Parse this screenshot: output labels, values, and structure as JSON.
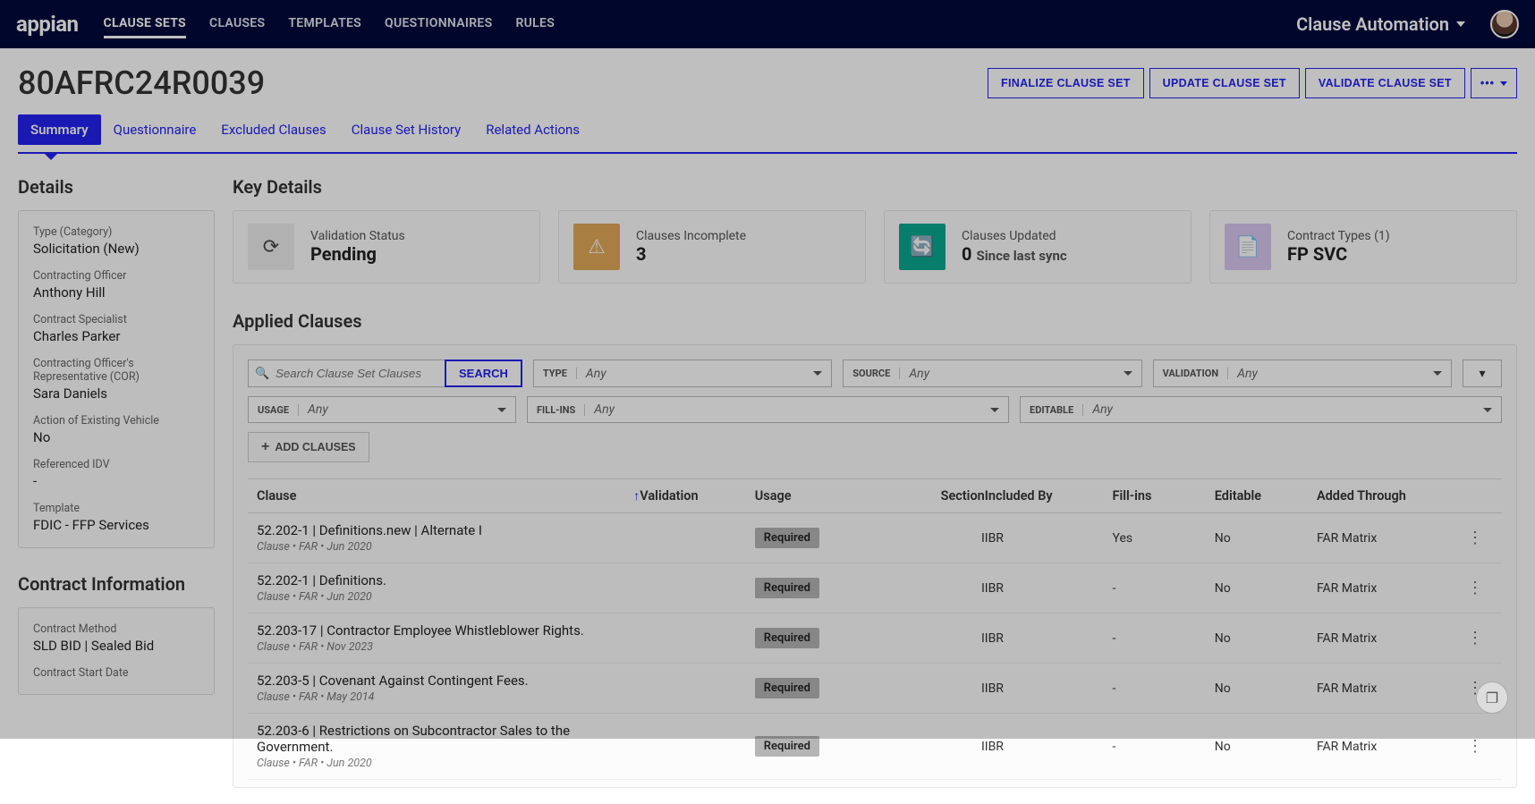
{
  "app": {
    "name": "Clause Automation",
    "logo_text": "appian"
  },
  "nav": {
    "items": [
      {
        "label": "CLAUSE SETS",
        "active": true
      },
      {
        "label": "CLAUSES"
      },
      {
        "label": "TEMPLATES"
      },
      {
        "label": "QUESTIONNAIRES"
      },
      {
        "label": "RULES"
      }
    ]
  },
  "header": {
    "title": "80AFRC24R0039",
    "actions": {
      "finalize": "FINALIZE CLAUSE SET",
      "update": "UPDATE CLAUSE SET",
      "validate": "VALIDATE CLAUSE SET"
    }
  },
  "tabs": [
    {
      "label": "Summary",
      "active": true
    },
    {
      "label": "Questionnaire"
    },
    {
      "label": "Excluded Clauses"
    },
    {
      "label": "Clause Set History"
    },
    {
      "label": "Related Actions"
    }
  ],
  "details": {
    "heading": "Details",
    "items": [
      {
        "label": "Type (Category)",
        "value": "Solicitation (New)"
      },
      {
        "label": "Contracting Officer",
        "value": "Anthony Hill"
      },
      {
        "label": "Contract Specialist",
        "value": "Charles Parker"
      },
      {
        "label": "Contracting Officer's Representative (COR)",
        "value": "Sara Daniels"
      },
      {
        "label": "Action of Existing Vehicle",
        "value": "No"
      },
      {
        "label": "Referenced IDV",
        "value": "-"
      },
      {
        "label": "Template",
        "value": "FDIC - FFP Services"
      }
    ],
    "contract_info_heading": "Contract Information",
    "contract_info": [
      {
        "label": "Contract Method",
        "value": "SLD BID | Sealed Bid"
      },
      {
        "label": "Contract Start Date",
        "value": ""
      }
    ]
  },
  "key_details": {
    "heading": "Key Details",
    "cards": [
      {
        "label": "Validation Status",
        "value": "Pending",
        "icon": "spinner"
      },
      {
        "label": "Clauses Incomplete",
        "value": "3",
        "icon": "warning"
      },
      {
        "label": "Clauses Updated",
        "value": "0",
        "suffix": "Since last sync",
        "icon": "sync"
      },
      {
        "label": "Contract Types (1)",
        "value": "FP SVC",
        "icon": "file"
      }
    ]
  },
  "applied": {
    "heading": "Applied Clauses",
    "search_placeholder": "Search Clause Set Clauses",
    "search_btn": "SEARCH",
    "filters": {
      "type": {
        "label": "TYPE",
        "value": "Any"
      },
      "source": {
        "label": "SOURCE",
        "value": "Any"
      },
      "validation": {
        "label": "VALIDATION",
        "value": "Any"
      },
      "usage": {
        "label": "USAGE",
        "value": "Any"
      },
      "fillins": {
        "label": "FILL-INS",
        "value": "Any"
      },
      "editable": {
        "label": "EDITABLE",
        "value": "Any"
      }
    },
    "add_btn": "ADD CLAUSES",
    "columns": [
      "Clause",
      "Validation",
      "Usage",
      "Section",
      "Included By",
      "Fill-ins",
      "Editable",
      "Added Through"
    ],
    "rows": [
      {
        "title": "52.202-1 | Definitions.new | Alternate I",
        "sub": "Clause • FAR • Jun 2020",
        "validation": "",
        "usage": "Required",
        "section": "I",
        "included_by": "IBR",
        "fill_ins": "Yes",
        "editable": "No",
        "added": "FAR Matrix"
      },
      {
        "title": "52.202-1 | Definitions.",
        "sub": "Clause • FAR • Jun 2020",
        "validation": "",
        "usage": "Required",
        "section": "I",
        "included_by": "IBR",
        "fill_ins": "-",
        "editable": "No",
        "added": "FAR Matrix"
      },
      {
        "title": "52.203-17 | Contractor Employee Whistleblower Rights.",
        "sub": "Clause • FAR • Nov 2023",
        "validation": "",
        "usage": "Required",
        "section": "I",
        "included_by": "IBR",
        "fill_ins": "-",
        "editable": "No",
        "added": "FAR Matrix"
      },
      {
        "title": "52.203-5 | Covenant Against Contingent Fees.",
        "sub": "Clause • FAR • May 2014",
        "validation": "",
        "usage": "Required",
        "section": "I",
        "included_by": "IBR",
        "fill_ins": "-",
        "editable": "No",
        "added": "FAR Matrix"
      },
      {
        "title": "52.203-6 | Restrictions on Subcontractor Sales to the Government.",
        "sub": "Clause • FAR • Jun 2020",
        "validation": "",
        "usage": "Required",
        "section": "I",
        "included_by": "IBR",
        "fill_ins": "-",
        "editable": "No",
        "added": "FAR Matrix"
      }
    ]
  }
}
